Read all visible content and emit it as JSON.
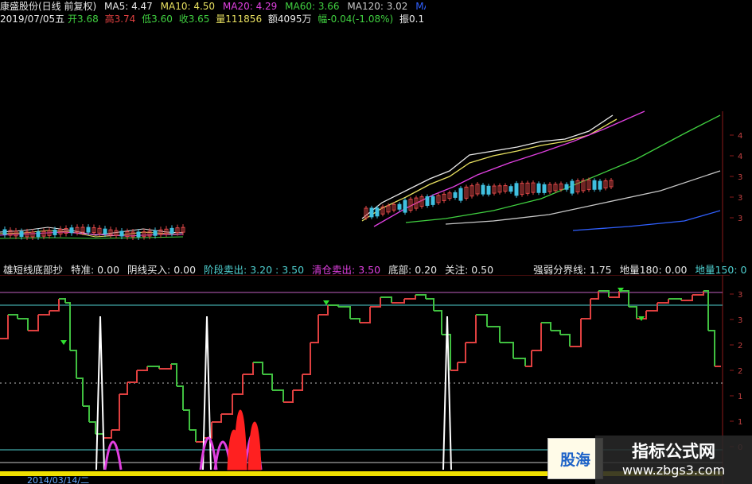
{
  "window": {
    "stock_title": "康盛股份(日线 前复权)",
    "ma_labels": [
      {
        "label": "MA5: 4.47",
        "color": "#e8e8e8"
      },
      {
        "label": "MA10: 4.50",
        "color": "#e8e060"
      },
      {
        "label": "MA20: 4.29",
        "color": "#e040e0"
      },
      {
        "label": "MA60: 3.66",
        "color": "#40d040"
      },
      {
        "label": "MA120: 3.02",
        "color": "#c8c8c8"
      },
      {
        "label": "MA",
        "color": "#3060ff"
      }
    ]
  },
  "ohlc": {
    "date": "2019/07/05五",
    "open_label": "开",
    "open": "3.68",
    "high_label": "高",
    "high": "3.74",
    "low_label": "低",
    "low": "3.60",
    "close_label": "收",
    "close": "3.65",
    "volume_label": "量",
    "volume": "111856",
    "amount_label": "额",
    "amount": "4095万",
    "change_label": "幅",
    "change": "-0.04(-1.08%)",
    "amplitude_label": "振",
    "amplitude": "0.1"
  },
  "indicator": {
    "name": "雄短线底部抄",
    "params": [
      {
        "label": "特准: 0.00",
        "color": "#e8e8e8"
      },
      {
        "label": "阴线买入: 0.00",
        "color": "#e8e8e8"
      },
      {
        "label": "阶段卖出: 3.20 : 3.50",
        "color": "#4fd0d0"
      },
      {
        "label": "清仓卖出: 3.50",
        "color": "#e040e0"
      },
      {
        "label": "底部: 0.20",
        "color": "#e8e8e8"
      },
      {
        "label": "关注: 0.50",
        "color": "#e8e8e8"
      },
      {
        "label": "强弱分界线: 1.75",
        "color": "#e8e8e8"
      },
      {
        "label": "地量180: 0.00",
        "color": "#e8e8e8"
      },
      {
        "label": "地量150: 0",
        "color": "#4fd0d0"
      }
    ]
  },
  "footer": {
    "date_partial": "2014/03/14/二"
  },
  "watermark": {
    "left_text": "股海",
    "title": "指标公式网",
    "url": "www.zbgs3.com"
  },
  "scale": {
    "main_ticks": [
      "4",
      "4",
      "3",
      "3",
      "3"
    ],
    "ind_ticks": [
      "3",
      "3",
      "2",
      "2",
      "1",
      "1",
      "0"
    ]
  },
  "chart_data": {
    "type": "line",
    "panels": [
      {
        "name": "price",
        "series": [
          {
            "name": "MA5",
            "color": "#e8e8e8"
          },
          {
            "name": "MA10",
            "color": "#e8e060"
          },
          {
            "name": "MA20",
            "color": "#e040e0"
          },
          {
            "name": "MA60",
            "color": "#40d040"
          },
          {
            "name": "MA120",
            "color": "#c8c8c8"
          },
          {
            "color": "#3060ff"
          }
        ]
      },
      {
        "name": "indicator",
        "series": [
          {
            "color": "#e04040"
          },
          {
            "color": "#ffffff"
          },
          {
            "color": "#e040e0"
          },
          {
            "color": "#ff2020"
          }
        ]
      }
    ]
  }
}
